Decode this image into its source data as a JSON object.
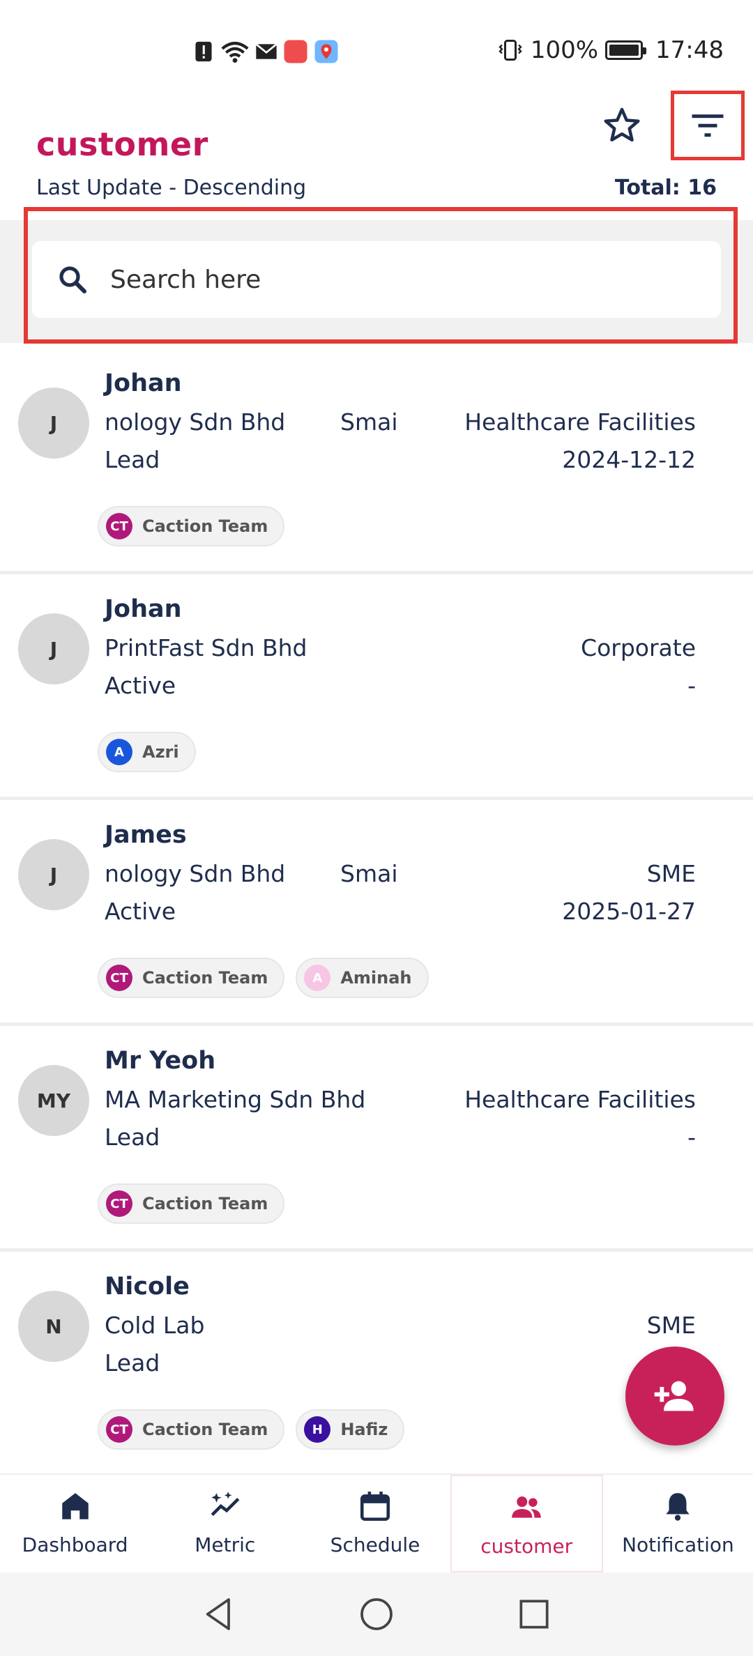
{
  "status_bar": {
    "battery": "100%",
    "time": "17:48"
  },
  "header": {
    "title": "customer",
    "sort_label": "Last Update - Descending",
    "total_label": "Total: 16"
  },
  "search": {
    "placeholder": "Search here"
  },
  "customers": [
    {
      "initials": "J",
      "name": "Johan",
      "company": "nology Sdn Bhd",
      "extra": "Smai",
      "status": "Lead",
      "category": "Healthcare Facilities",
      "date": "2024-12-12",
      "tags": [
        {
          "initials": "CT",
          "label": "Caction Team",
          "color": "#b0197a"
        }
      ]
    },
    {
      "initials": "J",
      "name": "Johan",
      "company": "PrintFast Sdn Bhd",
      "extra": "",
      "status": "Active",
      "category": "Corporate",
      "date": "-",
      "tags": [
        {
          "initials": "A",
          "label": "Azri",
          "color": "#1a56db"
        }
      ]
    },
    {
      "initials": "J",
      "name": "James",
      "company": "nology Sdn Bhd",
      "extra": "Smai",
      "status": "Active",
      "category": "SME",
      "date": "2025-01-27",
      "tags": [
        {
          "initials": "CT",
          "label": "Caction Team",
          "color": "#b0197a"
        },
        {
          "initials": "A",
          "label": "Aminah",
          "color": "#f7c6e4"
        }
      ]
    },
    {
      "initials": "MY",
      "name": "Mr Yeoh",
      "company": "MA Marketing Sdn Bhd",
      "extra": "",
      "status": "Lead",
      "category": "Healthcare Facilities",
      "date": "-",
      "tags": [
        {
          "initials": "CT",
          "label": "Caction Team",
          "color": "#b0197a"
        }
      ]
    },
    {
      "initials": "N",
      "name": "Nicole",
      "company": "Cold Lab",
      "extra": "",
      "status": "Lead",
      "category": "SME",
      "date": "",
      "tags": [
        {
          "initials": "CT",
          "label": "Caction Team",
          "color": "#b0197a"
        },
        {
          "initials": "H",
          "label": "Hafiz",
          "color": "#3b0fa0"
        }
      ]
    }
  ],
  "bottom_nav": [
    {
      "label": "Dashboard",
      "icon": "home-icon"
    },
    {
      "label": "Metric",
      "icon": "metric-icon"
    },
    {
      "label": "Schedule",
      "icon": "calendar-icon"
    },
    {
      "label": "customer",
      "icon": "customers-icon",
      "active": true
    },
    {
      "label": "Notification",
      "icon": "bell-icon"
    }
  ],
  "colors": {
    "brand": "#c2185b",
    "text": "#1f2d4d",
    "highlight_outline": "#e53935"
  }
}
